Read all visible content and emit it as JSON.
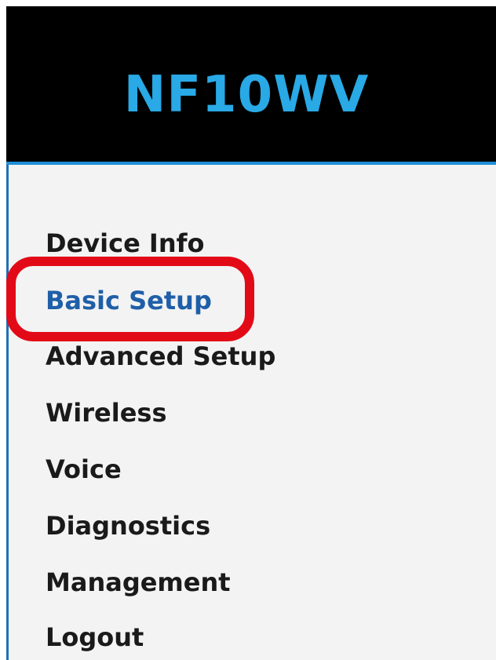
{
  "brand": {
    "title": "NF10WV"
  },
  "colors": {
    "brand_text": "#29a9e6",
    "accent_line": "#1e8fd6",
    "nav_text": "#1a1a1a",
    "nav_selected": "#1f5fa8",
    "highlight": "#e30a17"
  },
  "nav": {
    "items": [
      {
        "label": "Device Info"
      },
      {
        "label": "Basic Setup",
        "selected": true
      },
      {
        "label": "Advanced Setup"
      },
      {
        "label": "Wireless"
      },
      {
        "label": "Voice"
      },
      {
        "label": "Diagnostics"
      },
      {
        "label": "Management"
      },
      {
        "label": "Logout"
      }
    ]
  }
}
